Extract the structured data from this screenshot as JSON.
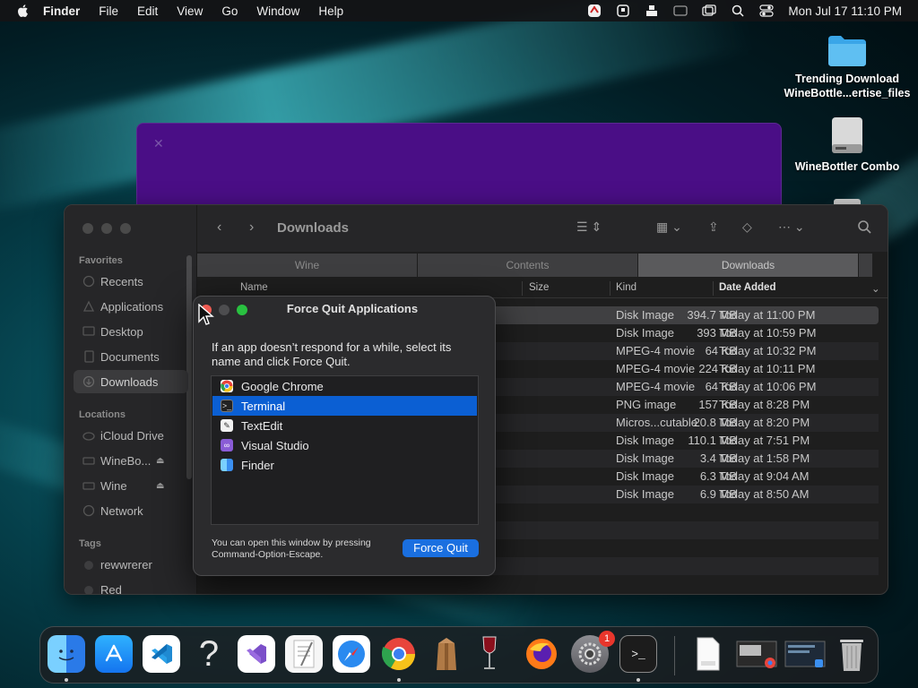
{
  "menubar": {
    "items": [
      "Finder",
      "File",
      "Edit",
      "View",
      "Go",
      "Window",
      "Help"
    ],
    "clock": "Mon Jul 17  11:10 PM",
    "status_icons": [
      "app-status-icon",
      "display-icon",
      "share-icon",
      "screen-mirror-icon",
      "window-icon",
      "search-icon",
      "control-center-icon"
    ]
  },
  "desktop": {
    "items": [
      {
        "label_line1": "Trending Download",
        "label_line2": "WineBottle...ertise_files",
        "icon": "folder-icon"
      },
      {
        "label_line1": "WineBottler Combo",
        "label_line2": "",
        "icon": "disk-image-icon"
      }
    ]
  },
  "finder": {
    "title": "Downloads",
    "sidebar": {
      "favorites_header": "Favorites",
      "favorites": [
        "Recents",
        "Applications",
        "Desktop",
        "Documents",
        "Downloads"
      ],
      "locations_header": "Locations",
      "locations": [
        "iCloud Drive",
        "WineBo...",
        "Wine",
        "Network"
      ],
      "tags_header": "Tags",
      "tags": [
        "rewwrerer",
        "Red"
      ]
    },
    "pathbar": [
      "Wine",
      "Contents",
      "Downloads"
    ],
    "columns": {
      "name": "Name",
      "size": "Size",
      "kind": "Kind",
      "date": "Date Added"
    },
    "rows": [
      {
        "size": "394.7 MB",
        "kind": "Disk Image",
        "date": "Today at 11:00 PM"
      },
      {
        "size": "393 MB",
        "kind": "Disk Image",
        "date": "Today at 10:59 PM"
      },
      {
        "size": "64 KB",
        "kind": "MPEG-4 movie",
        "date": "Today at 10:32 PM"
      },
      {
        "size": "224 KB",
        "kind": "MPEG-4 movie",
        "date": "Today at 10:11 PM"
      },
      {
        "size": "64 KB",
        "kind": "MPEG-4 movie",
        "date": "Today at 10:06 PM"
      },
      {
        "size": "157 KB",
        "kind": "PNG image",
        "date": "Today at 8:28 PM"
      },
      {
        "size": "20.8 MB",
        "kind": "Micros...cutable",
        "date": "Today at 8:20 PM"
      },
      {
        "size": "110.1 MB",
        "kind": "Disk Image",
        "date": "Today at 7:51 PM"
      },
      {
        "size": "3.4 MB",
        "kind": "Disk Image",
        "date": "Today at 1:58 PM"
      },
      {
        "size": "6.3 MB",
        "kind": "Disk Image",
        "date": "Today at 9:04 AM"
      },
      {
        "size": "6.9 MB",
        "kind": "Disk Image",
        "date": "Today at 8:50 AM"
      }
    ]
  },
  "force_quit": {
    "title": "Force Quit Applications",
    "message": "If an app doesn’t respond for a while, select its name and click Force Quit.",
    "apps": [
      {
        "name": "Google Chrome",
        "icon": "chrome-icon",
        "color": "#e8453c"
      },
      {
        "name": "Terminal",
        "icon": "terminal-icon",
        "color": "#222222"
      },
      {
        "name": "TextEdit",
        "icon": "textedit-icon",
        "color": "#f2f2f2"
      },
      {
        "name": "Visual Studio",
        "icon": "visual-studio-icon",
        "color": "#8a5cd6"
      },
      {
        "name": "Finder",
        "icon": "finder-icon",
        "color": "#3b8ff0"
      }
    ],
    "selected_index": 1,
    "footer": "You can open this window by pressing Command-Option-Escape.",
    "button": "Force Quit"
  },
  "dock": {
    "apps": [
      "finder-icon",
      "app-store-icon",
      "vscode-icon",
      "unknown-app-icon",
      "visual-studio-icon",
      "textedit-icon",
      "safari-icon",
      "chrome-icon",
      "archive-utility-icon",
      "wine-icon",
      "firefox-icon",
      "system-settings-icon",
      "terminal-icon",
      "html-file-icon",
      "screenshot-icon",
      "screenshot-icon-2",
      "trash-icon"
    ],
    "settings_badge": "1"
  },
  "colors": {
    "accent": "#0b5fd3",
    "button": "#1a6fe0",
    "purple_window": "#4a0e86"
  }
}
